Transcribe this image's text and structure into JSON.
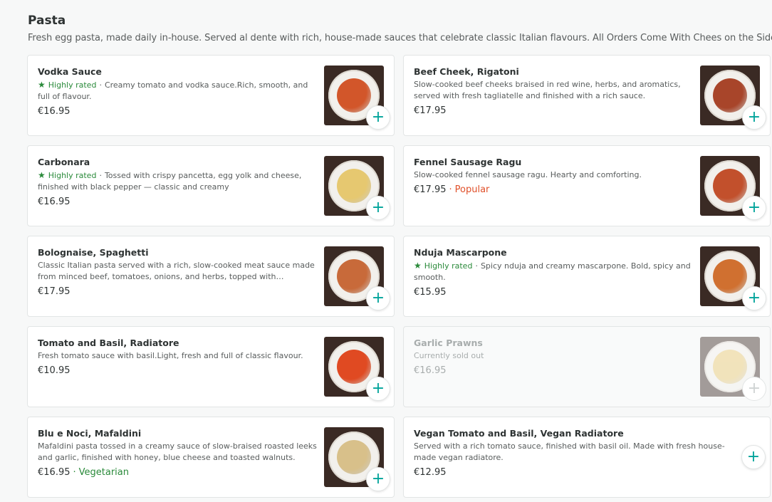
{
  "section": {
    "title": "Pasta",
    "description": "Fresh egg pasta, made daily in-house. Served al dente with rich, house-made sauces that celebrate classic Italian flavours. All Orders Come With Chees on the Side"
  },
  "colors": {
    "accent": "#00a39a",
    "rated": "#2a8a3a",
    "popular": "#e0502a"
  },
  "items": [
    {
      "name": "Vodka Sauce",
      "rated": "Highly rated",
      "description": "Creamy tomato and vodka sauce.Rich, smooth, and full of flavour.",
      "price": "€16.95",
      "tag": "",
      "sold_out": false,
      "has_image": true,
      "food_color": "#d2562a"
    },
    {
      "name": "Beef Cheek, Rigatoni",
      "rated": "",
      "description": "Slow-cooked beef cheeks braised in red wine, herbs, and aromatics, served with fresh tagliatelle and finished with a rich sauce.",
      "price": "€17.95",
      "tag": "",
      "sold_out": false,
      "has_image": true,
      "food_color": "#a8452a"
    },
    {
      "name": "Carbonara",
      "rated": "Highly rated",
      "description": "Tossed with crispy pancetta, egg yolk and cheese, finished with black pepper — classic and creamy",
      "price": "€16.95",
      "tag": "",
      "sold_out": false,
      "has_image": true,
      "food_color": "#e6c870"
    },
    {
      "name": "Fennel Sausage Ragu",
      "rated": "",
      "description": "Slow-cooked fennel sausage ragu. Hearty and comforting.",
      "price": "€17.95",
      "tag": "Popular",
      "sold_out": false,
      "has_image": true,
      "food_color": "#c2502c"
    },
    {
      "name": "Bolognaise, Spaghetti",
      "rated": "",
      "description": "Classic Italian pasta served with a rich, slow-cooked meat sauce made from minced beef, tomatoes, onions, and herbs, topped with Parmesa...",
      "price": "€17.95",
      "tag": "",
      "sold_out": false,
      "has_image": true,
      "food_color": "#c86a3a"
    },
    {
      "name": "Nduja Mascarpone",
      "rated": "Highly rated",
      "description": "Spicy nduja and creamy mascarpone. Bold, spicy and smooth.",
      "price": "€15.95",
      "tag": "",
      "sold_out": false,
      "has_image": true,
      "food_color": "#d07030"
    },
    {
      "name": "Tomato and Basil, Radiatore",
      "rated": "",
      "description": "Fresh tomato sauce with basil.Light, fresh and full of classic flavour.",
      "price": "€10.95",
      "tag": "",
      "sold_out": false,
      "has_image": true,
      "food_color": "#e04a22"
    },
    {
      "name": "Garlic Prawns",
      "rated": "",
      "description": "Currently sold out",
      "price": "€16.95",
      "tag": "",
      "sold_out": true,
      "has_image": true,
      "food_color": "#e8c870"
    },
    {
      "name": "Blu e Noci, Mafaldini",
      "rated": "",
      "description": "Mafaldini pasta tossed in a creamy sauce of slow-braised roasted leeks and garlic, finished with honey, blue cheese and toasted walnuts.",
      "price": "€16.95",
      "tag": "Vegetarian",
      "sold_out": false,
      "has_image": true,
      "food_color": "#d8c08a"
    },
    {
      "name": "Vegan Tomato and Basil, Vegan Radiatore",
      "rated": "",
      "description": "Served with a rich tomato sauce, finished with basil oil. Made with fresh house-made vegan radiatore.",
      "price": "€12.95",
      "tag": "",
      "sold_out": false,
      "has_image": false,
      "food_color": ""
    }
  ],
  "labels": {
    "add_symbol": "+",
    "separator": "·",
    "star": "★"
  }
}
